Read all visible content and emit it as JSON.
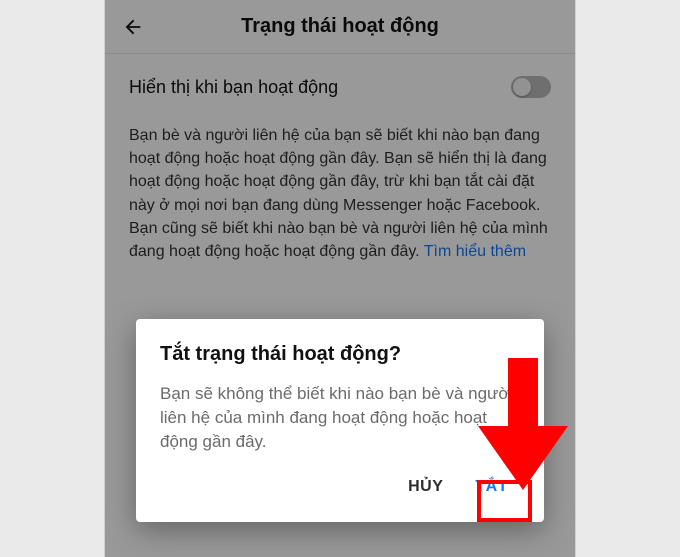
{
  "header": {
    "title": "Trạng thái hoạt động"
  },
  "setting": {
    "label": "Hiển thị khi bạn hoạt động",
    "toggle_on": false,
    "description": "Bạn bè và người liên hệ của bạn sẽ biết khi nào bạn đang hoạt động hoặc hoạt động gần đây. Bạn sẽ hiển thị là đang hoạt động hoặc hoạt động gần đây, trừ khi bạn tắt cài đặt này ở mọi nơi bạn đang dùng Messenger hoặc Facebook. Bạn cũng sẽ biết khi nào bạn bè và người liên hệ của mình đang hoạt động hoặc hoạt động gần đây.",
    "link_label": "Tìm hiểu thêm"
  },
  "dialog": {
    "title": "Tắt trạng thái hoạt động?",
    "body": "Bạn sẽ không thể biết khi nào bạn bè và người liên hệ của mình đang hoạt động hoặc hoạt động gần đây.",
    "cancel_label": "HỦY",
    "confirm_label": "TẮT"
  },
  "colors": {
    "link": "#1877f2",
    "highlight": "#ff0000"
  }
}
